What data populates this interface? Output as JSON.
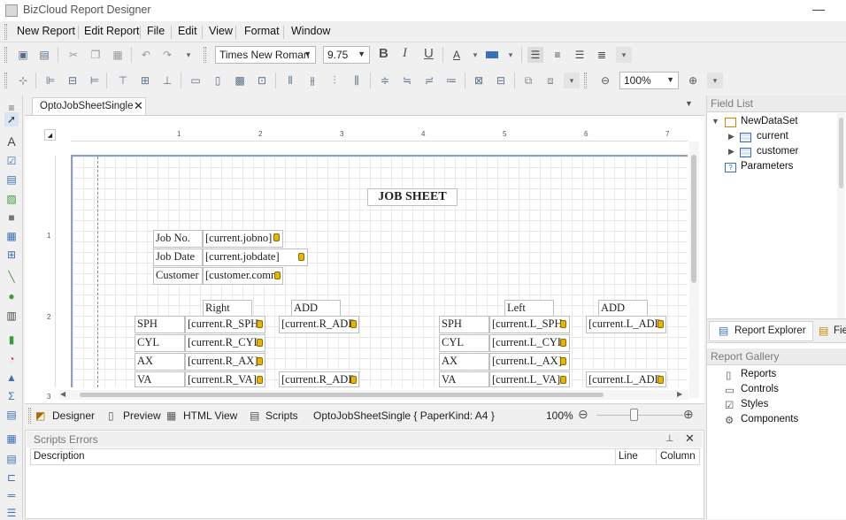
{
  "app": {
    "title": "BizCloud Report Designer"
  },
  "menu": [
    "New Report",
    "Edit Report",
    "File",
    "Edit",
    "View",
    "Format",
    "Window"
  ],
  "toolbar": {
    "font_name": "Times New Roman",
    "font_size": "9.75",
    "zoom": "100%",
    "bold": "B",
    "italic": "I",
    "underline": "U"
  },
  "doc_tab": {
    "label": "OptoJobSheetSingle",
    "close": "✕"
  },
  "ruler": {
    "h_ticks": [
      "1",
      "2",
      "3",
      "4",
      "5",
      "6",
      "7"
    ],
    "v_ticks": [
      "1",
      "2",
      "3"
    ]
  },
  "report": {
    "title": "JOB SHEET",
    "header_labels": {
      "job_no": "Job No.",
      "job_date": "Job Date",
      "customer": "Customer"
    },
    "header_fields": {
      "job_no": "[current.jobno]",
      "job_date": "[current.jobdate]",
      "customer": "[customer.comm"
    },
    "right_heading": "Right",
    "left_heading": "Left",
    "add_heading_r": "ADD",
    "add_heading_l": "ADD",
    "rows": [
      {
        "label": "SPH",
        "right": "[current.R_SPH",
        "r_add": "[current.R_ADD",
        "left_label": "SPH",
        "left": "[current.L_SPH",
        "l_add": "[current.L_ADD"
      },
      {
        "label": "CYL",
        "right": "[current.R_CYL",
        "r_add": "",
        "left_label": "CYL",
        "left": "[current.L_CYL",
        "l_add": ""
      },
      {
        "label": "AX",
        "right": "[current.R_AX]",
        "r_add": "",
        "left_label": "AX",
        "left": "[current.L_AX]",
        "l_add": ""
      },
      {
        "label": "VA",
        "right": "[current.R_VA]",
        "r_add": "[current.R_ADD",
        "left_label": "VA",
        "left": "[current.L_VA]",
        "l_add": "[current.L_ADD"
      }
    ]
  },
  "status_tabs": {
    "designer": "Designer",
    "preview": "Preview",
    "html_view": "HTML View",
    "scripts": "Scripts",
    "doc_info": "OptoJobSheetSingle { PaperKind: A4 }",
    "zoom": "100%"
  },
  "scripts_errors": {
    "title": "Scripts Errors",
    "columns": [
      "Description",
      "Line",
      "Column"
    ]
  },
  "field_list": {
    "title": "Field List",
    "items": [
      {
        "label": "NewDataSet",
        "level": 0
      },
      {
        "label": "current",
        "level": 1
      },
      {
        "label": "customer",
        "level": 1
      },
      {
        "label": "Parameters",
        "level": 0
      }
    ]
  },
  "right_tabs": {
    "report_explorer": "Report Explorer",
    "field": "Fie"
  },
  "report_gallery": {
    "title": "Report Gallery",
    "items": [
      "Reports",
      "Controls",
      "Styles",
      "Components"
    ]
  },
  "colors": {
    "accent": "#3b6fb6",
    "db_icon": "#e9b400",
    "page_border": "#8da2b8"
  }
}
